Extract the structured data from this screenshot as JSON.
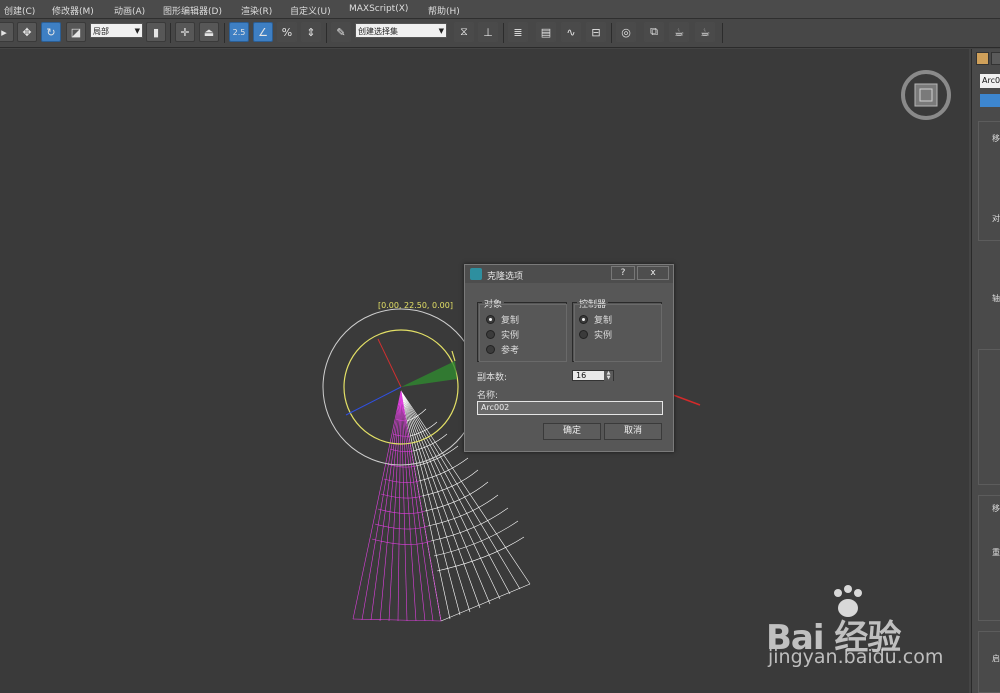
{
  "menubar": {
    "items": [
      "创建(C)",
      "修改器(M)",
      "动画(A)",
      "图形编辑器(D)",
      "渲染(R)",
      "自定义(U)",
      "MAXScript(X)",
      "帮助(H)"
    ]
  },
  "toolbar": {
    "ref_coord_value": "局部",
    "snap_value": "2.5",
    "named_selection_value": "创建选择集"
  },
  "viewport": {
    "coord_readout": "[0.00, 22.50, 0.00]"
  },
  "right_panel": {
    "object_name": "Arc0",
    "labels": [
      "移",
      "对",
      "轴",
      "移",
      "重",
      "启"
    ]
  },
  "clone_dialog": {
    "title": "克隆选项",
    "help_label": "?",
    "close_label": "x",
    "object_group": {
      "legend": "对象",
      "options": [
        "复制",
        "实例",
        "参考"
      ],
      "selected": "复制"
    },
    "controller_group": {
      "legend": "控制器",
      "options": [
        "复制",
        "实例"
      ],
      "selected": "复制"
    },
    "copies_label": "副本数:",
    "copies_value": "16",
    "name_label": "名称:",
    "name_value": "Arc002",
    "ok_label": "确定",
    "cancel_label": "取消"
  },
  "watermark": {
    "brand": "Bai 经验",
    "url": "jingyan.baidu.com"
  },
  "colors": {
    "accent_active": "#3e7fc3",
    "viewport_bg": "#3a3a3a",
    "selection_yellow": "#e3e066",
    "wire_magenta": "#e040e0",
    "annotation_red": "#d42a2a"
  }
}
